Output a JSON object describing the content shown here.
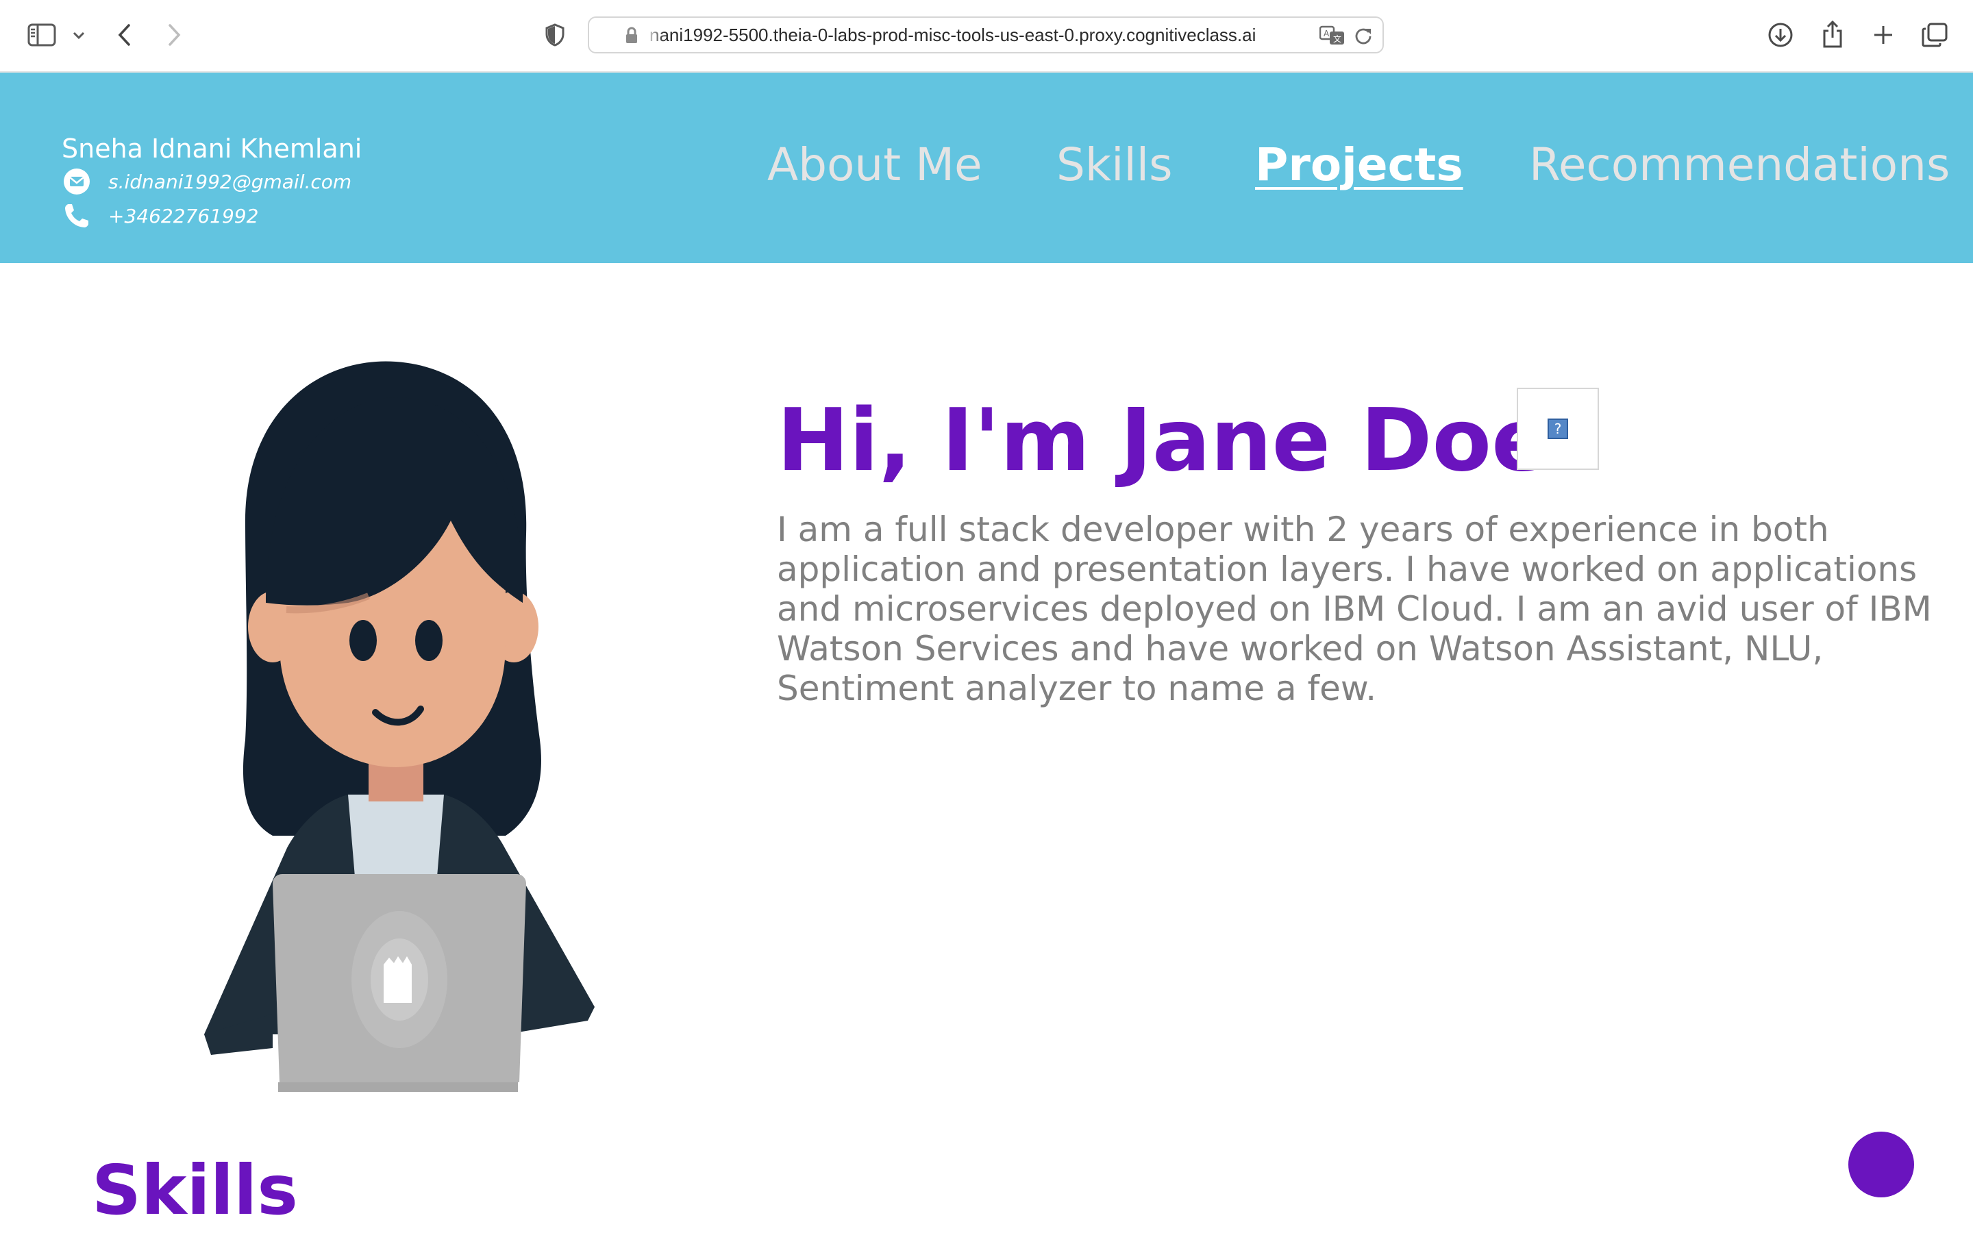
{
  "browser": {
    "url": "nani1992-5500.theia-0-labs-prod-misc-tools-us-east-0.proxy.cognitiveclass.ai",
    "icons": [
      "sidebar-icon",
      "chevron-down-icon",
      "back-icon",
      "forward-icon",
      "shield-icon",
      "lock-icon",
      "translate-icon",
      "reload-icon",
      "download-icon",
      "share-icon",
      "new-tab-icon",
      "tabs-overview-icon"
    ]
  },
  "header": {
    "name": "Sneha Idnani Khemlani",
    "email": "s.idnani1992@gmail.com",
    "phone": "+34622761992",
    "bg_color": "#62c4e0",
    "nav": {
      "about": "About Me",
      "skills": "Skills",
      "projects": "Projects",
      "recommendations": "Recommendations",
      "active": "Projects"
    }
  },
  "hero": {
    "title": "Hi, I'm Jane Doe!",
    "intro": "I am a full stack developer with 2 years of experience in both application and presentation layers. I have worked on applications and microservices deployed on IBM Cloud. I am an avid user of IBM Watson Services and have worked on Watson Assistant, NLU, Sentiment analyzer to name a few.",
    "accent_color": "#6a14be",
    "broken_image_icon": "broken-image-icon"
  },
  "skills": {
    "heading": "Skills"
  },
  "fab": {
    "color": "#6a14be"
  }
}
